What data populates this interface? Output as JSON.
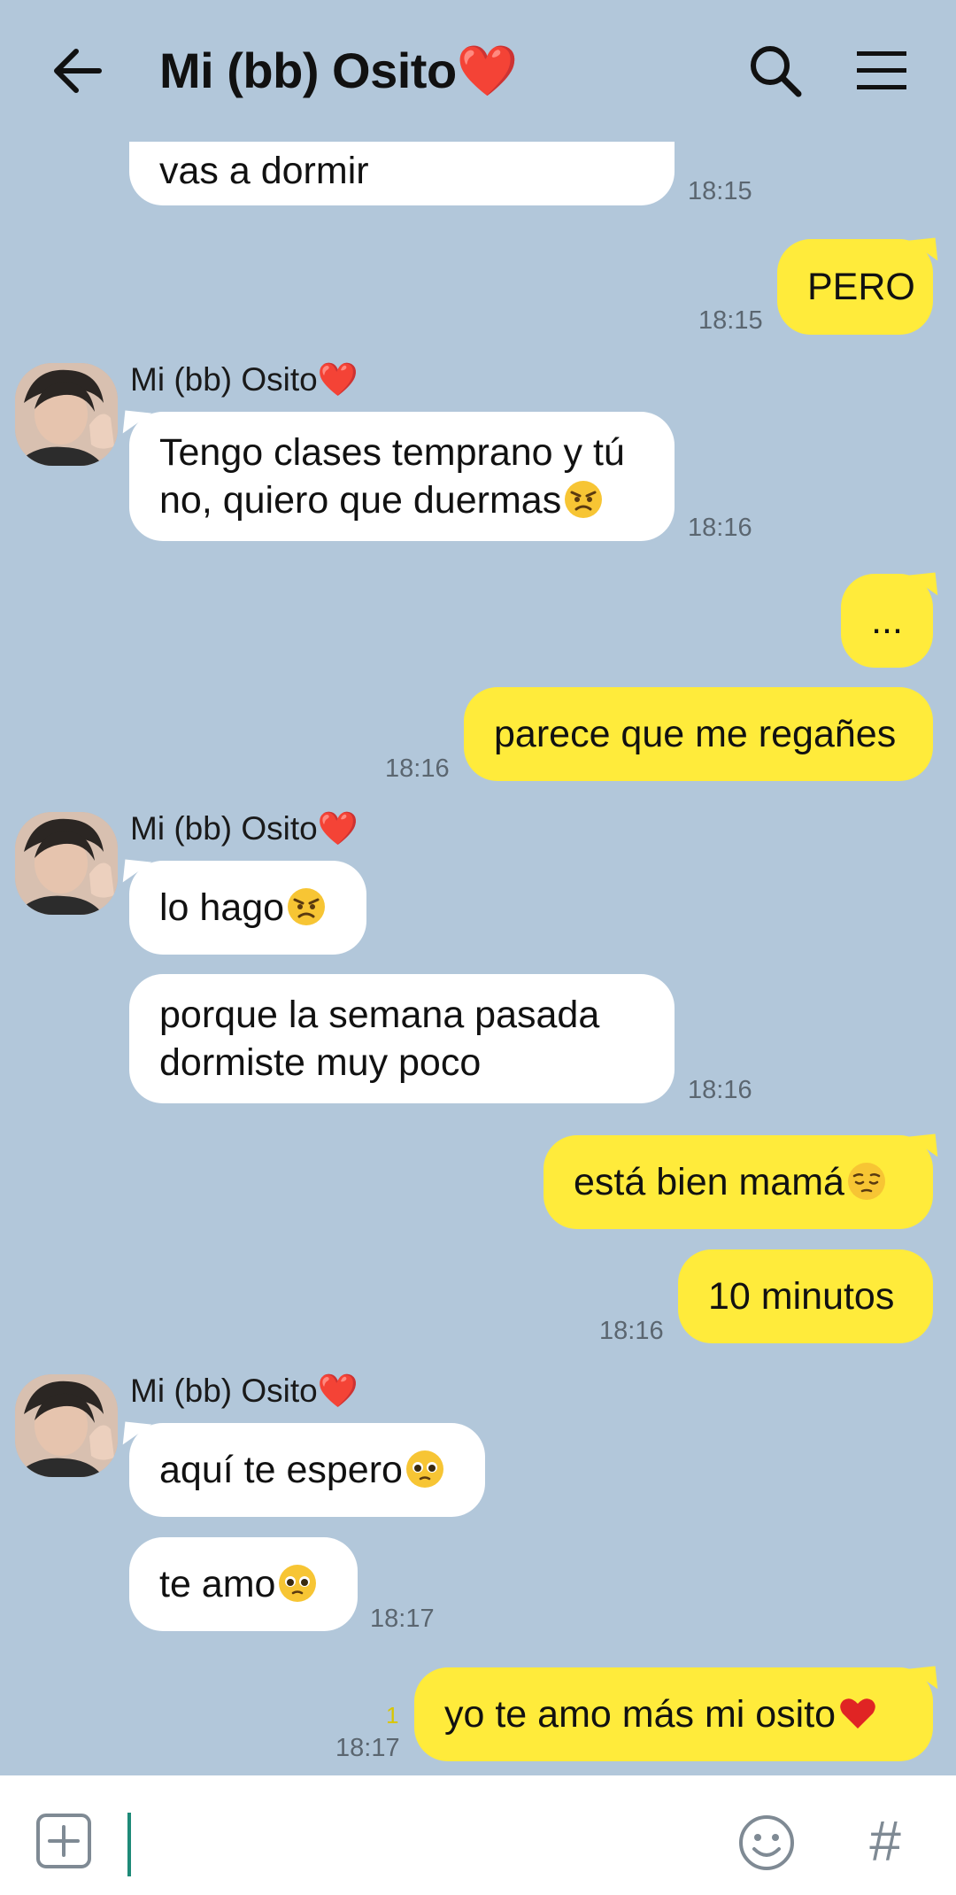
{
  "header": {
    "title": "Mi (bb) Osito❤️"
  },
  "messages": {
    "m1": {
      "text": "vas a dormir",
      "time": "18:15"
    },
    "m2": {
      "text": "PERO",
      "time": "18:15"
    },
    "m3": {
      "sender": "Mi (bb) Osito❤️",
      "text": "Tengo clases temprano y tú no, quiero que duermas",
      "line1": "Tengo clases temprano y tú",
      "line2": "no, quiero que duermas",
      "emoji": "angry-face",
      "time": "18:16"
    },
    "m4": {
      "text": "..."
    },
    "m5": {
      "text": "parece que me regañes",
      "time": "18:16"
    },
    "m6": {
      "sender": "Mi (bb) Osito❤️",
      "text": "lo hago",
      "emoji": "angry-face"
    },
    "m7": {
      "line1": "porque la semana pasada",
      "line2": "dormiste muy poco",
      "time": "18:16"
    },
    "m8": {
      "text": "está bien mamá",
      "emoji": "pensive-face"
    },
    "m9": {
      "text": "10 minutos",
      "time": "18:16"
    },
    "m10": {
      "sender": "Mi (bb) Osito❤️",
      "text": "aquí te espero",
      "emoji": "pleading-face"
    },
    "m11": {
      "text": "te amo",
      "emoji": "pleading-face",
      "time": "18:17"
    },
    "m12": {
      "text": "yo te amo más mi osito",
      "emoji": "red-heart",
      "time": "18:17",
      "read_count": "1"
    }
  },
  "input": {
    "placeholder": ""
  },
  "colors": {
    "background": "#b2c7da",
    "outgoing": "#ffeb3b",
    "incoming": "#ffffff",
    "time": "#5b6670",
    "cursor": "#1e8a78"
  }
}
